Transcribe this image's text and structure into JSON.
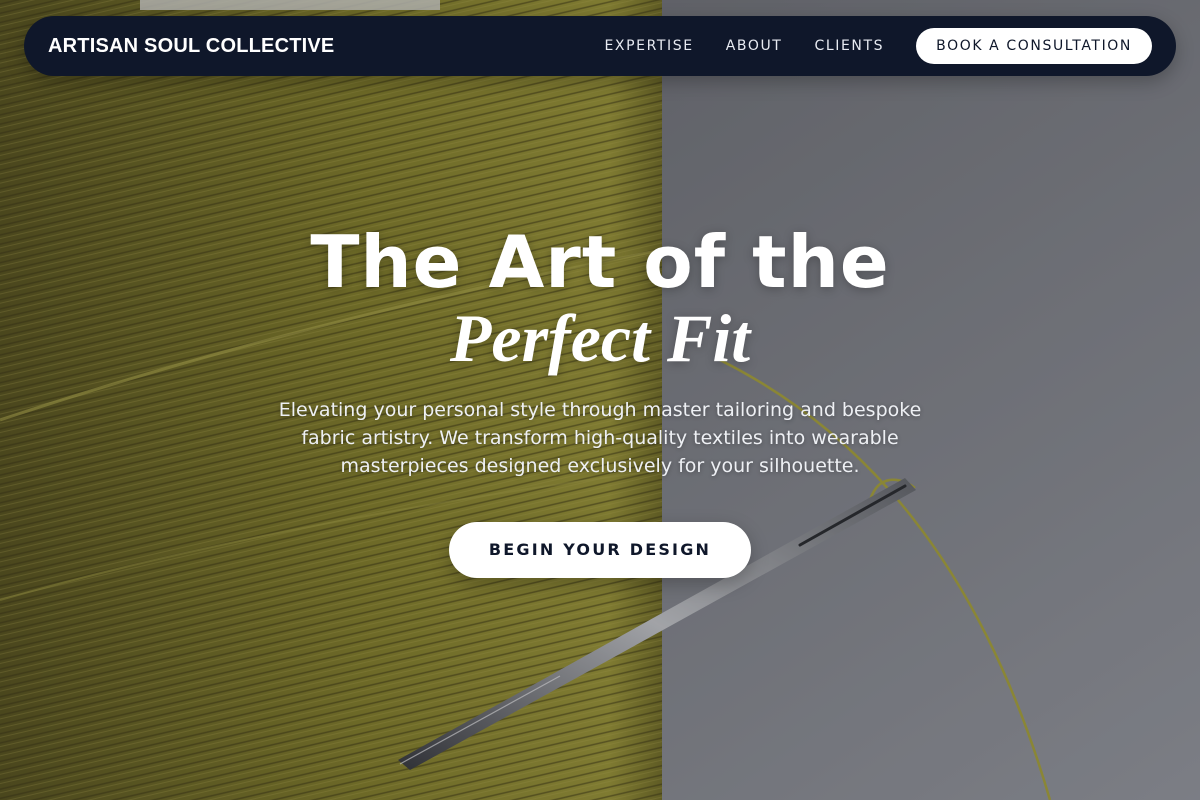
{
  "nav": {
    "brand": "ARTISAN SOUL COLLECTIVE",
    "links": [
      "EXPERTISE",
      "ABOUT",
      "CLIENTS"
    ],
    "cta": "BOOK A CONSULTATION"
  },
  "hero": {
    "title_line1": "The Art of the",
    "title_line2": "Perfect Fit",
    "description": "Elevating your personal style through master tailoring and bespoke fabric artistry. We transform high-quality textiles into wearable masterpieces designed exclusively for your silhouette.",
    "cta": "BEGIN YOUR DESIGN",
    "background_image": "thread-spool-and-needle-photo"
  },
  "colors": {
    "nav_bg": "#0f172a",
    "thread": "#9a9433",
    "backdrop": "#8c8e93",
    "button_bg": "#ffffff"
  }
}
